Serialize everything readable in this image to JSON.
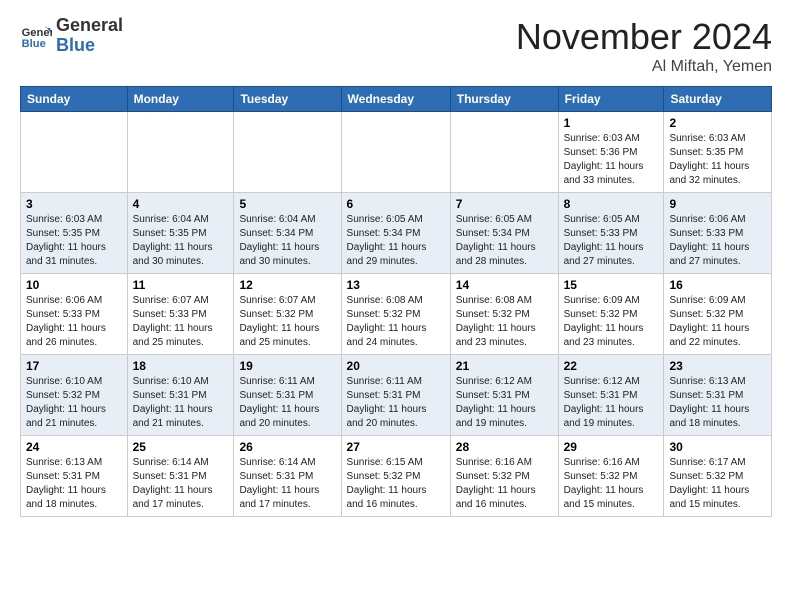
{
  "logo": {
    "general": "General",
    "blue": "Blue"
  },
  "header": {
    "month": "November 2024",
    "location": "Al Miftah, Yemen"
  },
  "weekdays": [
    "Sunday",
    "Monday",
    "Tuesday",
    "Wednesday",
    "Thursday",
    "Friday",
    "Saturday"
  ],
  "weeks": [
    [
      {
        "day": "",
        "info": ""
      },
      {
        "day": "",
        "info": ""
      },
      {
        "day": "",
        "info": ""
      },
      {
        "day": "",
        "info": ""
      },
      {
        "day": "",
        "info": ""
      },
      {
        "day": "1",
        "info": "Sunrise: 6:03 AM\nSunset: 5:36 PM\nDaylight: 11 hours and 33 minutes."
      },
      {
        "day": "2",
        "info": "Sunrise: 6:03 AM\nSunset: 5:35 PM\nDaylight: 11 hours and 32 minutes."
      }
    ],
    [
      {
        "day": "3",
        "info": "Sunrise: 6:03 AM\nSunset: 5:35 PM\nDaylight: 11 hours and 31 minutes."
      },
      {
        "day": "4",
        "info": "Sunrise: 6:04 AM\nSunset: 5:35 PM\nDaylight: 11 hours and 30 minutes."
      },
      {
        "day": "5",
        "info": "Sunrise: 6:04 AM\nSunset: 5:34 PM\nDaylight: 11 hours and 30 minutes."
      },
      {
        "day": "6",
        "info": "Sunrise: 6:05 AM\nSunset: 5:34 PM\nDaylight: 11 hours and 29 minutes."
      },
      {
        "day": "7",
        "info": "Sunrise: 6:05 AM\nSunset: 5:34 PM\nDaylight: 11 hours and 28 minutes."
      },
      {
        "day": "8",
        "info": "Sunrise: 6:05 AM\nSunset: 5:33 PM\nDaylight: 11 hours and 27 minutes."
      },
      {
        "day": "9",
        "info": "Sunrise: 6:06 AM\nSunset: 5:33 PM\nDaylight: 11 hours and 27 minutes."
      }
    ],
    [
      {
        "day": "10",
        "info": "Sunrise: 6:06 AM\nSunset: 5:33 PM\nDaylight: 11 hours and 26 minutes."
      },
      {
        "day": "11",
        "info": "Sunrise: 6:07 AM\nSunset: 5:33 PM\nDaylight: 11 hours and 25 minutes."
      },
      {
        "day": "12",
        "info": "Sunrise: 6:07 AM\nSunset: 5:32 PM\nDaylight: 11 hours and 25 minutes."
      },
      {
        "day": "13",
        "info": "Sunrise: 6:08 AM\nSunset: 5:32 PM\nDaylight: 11 hours and 24 minutes."
      },
      {
        "day": "14",
        "info": "Sunrise: 6:08 AM\nSunset: 5:32 PM\nDaylight: 11 hours and 23 minutes."
      },
      {
        "day": "15",
        "info": "Sunrise: 6:09 AM\nSunset: 5:32 PM\nDaylight: 11 hours and 23 minutes."
      },
      {
        "day": "16",
        "info": "Sunrise: 6:09 AM\nSunset: 5:32 PM\nDaylight: 11 hours and 22 minutes."
      }
    ],
    [
      {
        "day": "17",
        "info": "Sunrise: 6:10 AM\nSunset: 5:32 PM\nDaylight: 11 hours and 21 minutes."
      },
      {
        "day": "18",
        "info": "Sunrise: 6:10 AM\nSunset: 5:31 PM\nDaylight: 11 hours and 21 minutes."
      },
      {
        "day": "19",
        "info": "Sunrise: 6:11 AM\nSunset: 5:31 PM\nDaylight: 11 hours and 20 minutes."
      },
      {
        "day": "20",
        "info": "Sunrise: 6:11 AM\nSunset: 5:31 PM\nDaylight: 11 hours and 20 minutes."
      },
      {
        "day": "21",
        "info": "Sunrise: 6:12 AM\nSunset: 5:31 PM\nDaylight: 11 hours and 19 minutes."
      },
      {
        "day": "22",
        "info": "Sunrise: 6:12 AM\nSunset: 5:31 PM\nDaylight: 11 hours and 19 minutes."
      },
      {
        "day": "23",
        "info": "Sunrise: 6:13 AM\nSunset: 5:31 PM\nDaylight: 11 hours and 18 minutes."
      }
    ],
    [
      {
        "day": "24",
        "info": "Sunrise: 6:13 AM\nSunset: 5:31 PM\nDaylight: 11 hours and 18 minutes."
      },
      {
        "day": "25",
        "info": "Sunrise: 6:14 AM\nSunset: 5:31 PM\nDaylight: 11 hours and 17 minutes."
      },
      {
        "day": "26",
        "info": "Sunrise: 6:14 AM\nSunset: 5:31 PM\nDaylight: 11 hours and 17 minutes."
      },
      {
        "day": "27",
        "info": "Sunrise: 6:15 AM\nSunset: 5:32 PM\nDaylight: 11 hours and 16 minutes."
      },
      {
        "day": "28",
        "info": "Sunrise: 6:16 AM\nSunset: 5:32 PM\nDaylight: 11 hours and 16 minutes."
      },
      {
        "day": "29",
        "info": "Sunrise: 6:16 AM\nSunset: 5:32 PM\nDaylight: 11 hours and 15 minutes."
      },
      {
        "day": "30",
        "info": "Sunrise: 6:17 AM\nSunset: 5:32 PM\nDaylight: 11 hours and 15 minutes."
      }
    ]
  ]
}
